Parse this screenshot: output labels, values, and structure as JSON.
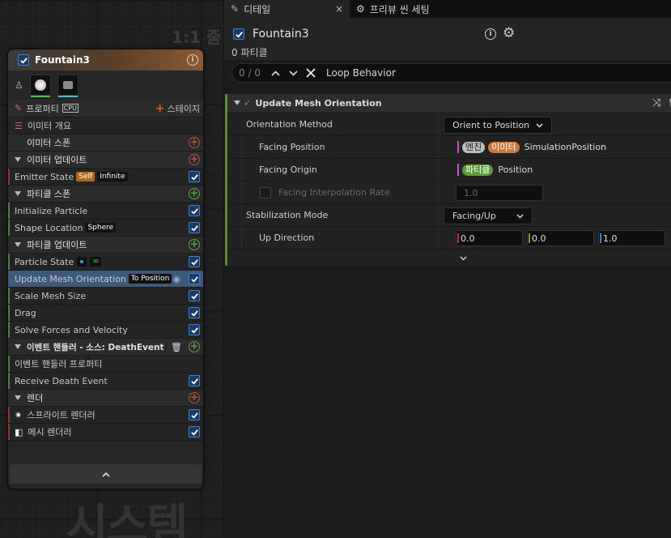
{
  "graph": {
    "zoom_label": "1:1 줌",
    "watermark": "시스템",
    "node": {
      "title": "Fountain3",
      "header_color": "#8a5a34",
      "properties_label": "프로퍼티",
      "cpu_label": "CPU",
      "stage_label": "스테이지",
      "rows": [
        {
          "kind": "item",
          "label": "이미터 개요",
          "icon": "list-icon"
        },
        {
          "kind": "section",
          "label": "이미터 스폰",
          "add": "red",
          "arrow": false
        },
        {
          "kind": "section",
          "label": "이미터 업데이트",
          "add": "red",
          "arrow": true
        },
        {
          "kind": "item",
          "label": "Emitter State",
          "tags": [
            "Self",
            "Infinite"
          ],
          "checked": true,
          "stripe": "red"
        },
        {
          "kind": "section",
          "label": "파티클 스폰",
          "add": "green",
          "arrow": true
        },
        {
          "kind": "item",
          "label": "Initialize Particle",
          "checked": true,
          "stripe": "green"
        },
        {
          "kind": "item",
          "label": "Shape Location",
          "tags": [
            "Sphere"
          ],
          "checked": true,
          "stripe": "green"
        },
        {
          "kind": "section",
          "label": "파티클 업데이트",
          "add": "green",
          "arrow": true
        },
        {
          "kind": "item",
          "label": "Particle State",
          "checked": true,
          "stripe": "green",
          "badges": true
        },
        {
          "kind": "item",
          "label": "Update Mesh Orientation",
          "tags": [
            "To Position"
          ],
          "checked": true,
          "selected": true,
          "eye": true
        },
        {
          "kind": "item",
          "label": "Scale Mesh Size",
          "checked": true,
          "stripe": "green"
        },
        {
          "kind": "item",
          "label": "Drag",
          "checked": true,
          "stripe": "green"
        },
        {
          "kind": "item",
          "label": "Solve Forces and Velocity",
          "checked": true,
          "stripe": "green"
        },
        {
          "kind": "section",
          "label": "이벤트 핸들러 - 소스: DeathEvent",
          "add": "green",
          "arrow": true,
          "trash": true
        },
        {
          "kind": "item",
          "label": "이벤트 핸들러 프로퍼티",
          "stripe": "green"
        },
        {
          "kind": "item",
          "label": "Receive Death Event",
          "checked": true,
          "stripe": "green"
        },
        {
          "kind": "section",
          "label": "렌더",
          "add": "red",
          "arrow": true
        },
        {
          "kind": "item",
          "label": "스프라이트 렌더러",
          "checked": true,
          "stripe": "red",
          "icon": "sprite-icon"
        },
        {
          "kind": "item",
          "label": "메시 렌더러",
          "checked": true,
          "stripe": "red",
          "icon": "mesh-icon"
        }
      ]
    }
  },
  "panel": {
    "tabs": [
      {
        "label": "디테일",
        "active": true,
        "close": "×"
      },
      {
        "label": "프리뷰 씬 세팅",
        "active": false
      }
    ],
    "object_title": "Fountain3",
    "particle_count": "0 파티클",
    "search": {
      "count": "0 / 0",
      "text": "Loop Behavior"
    },
    "module": {
      "title": "Update Mesh Orientation",
      "props": {
        "orientation_method": {
          "name": "Orientation Method",
          "value": "Orient to Position"
        },
        "facing_position": {
          "name": "Facing Position",
          "pill1": "엔진",
          "pill2": "이미터",
          "value": "SimulationPosition"
        },
        "facing_origin": {
          "name": "Facing Origin",
          "pill1": "파티클",
          "value": "Position"
        },
        "facing_interp": {
          "name": "Facing Interpolation Rate",
          "value": "1.0"
        },
        "stabilization": {
          "name": "Stabilization Mode",
          "value": "Facing/Up"
        },
        "up_direction": {
          "name": "Up Direction",
          "x": "0.0",
          "y": "0.0",
          "z": "1.0"
        }
      }
    }
  }
}
